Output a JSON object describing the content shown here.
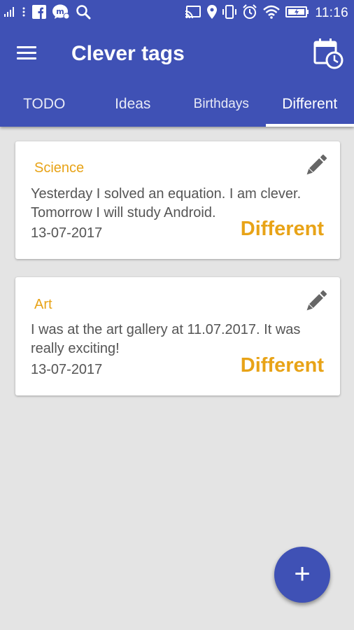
{
  "status_bar": {
    "time": "11:16",
    "left_icons": [
      "signal-icon",
      "more-icon",
      "facebook-icon",
      "messenger-icon",
      "search-icon"
    ],
    "right_icons": [
      "cast-icon",
      "location-icon",
      "vibrate-icon",
      "alarm-icon",
      "wifi-icon",
      "battery-icon"
    ]
  },
  "toolbar": {
    "title": "Clever tags",
    "menu_icon": "menu-icon",
    "calendar_icon": "calendar-clock-icon"
  },
  "tabs": [
    {
      "label": "TODO",
      "active": false
    },
    {
      "label": "Ideas",
      "active": false
    },
    {
      "label": "Birthdays",
      "active": false
    },
    {
      "label": "Different",
      "active": true
    }
  ],
  "notes": [
    {
      "category": "Science",
      "text": "Yesterday I solved an equation. I am clever. Tomorrow I will study Android.",
      "date": "13-07-2017",
      "tag": "Different"
    },
    {
      "category": "Art",
      "text": "I was at the art gallery at 11.07.2017. It was really exciting!",
      "date": "13-07-2017",
      "tag": "Different"
    }
  ],
  "fab": {
    "label": "+"
  },
  "colors": {
    "primary": "#3f51b5",
    "accent": "#e8a317",
    "background": "#e4e4e4"
  }
}
